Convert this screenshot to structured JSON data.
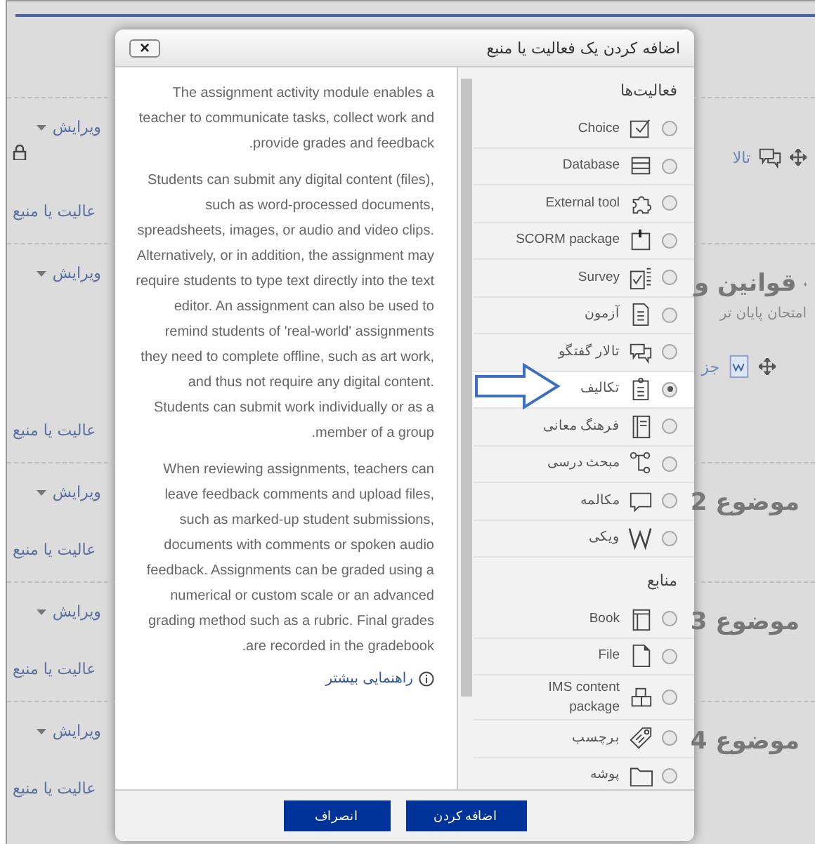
{
  "background": {
    "left_sections": [
      {
        "edit": "ویرایش",
        "locked": true,
        "link": "عالیت یا منبع"
      },
      {
        "edit": "ویرایش",
        "locked": false,
        "link": "عالیت یا منبع"
      },
      {
        "edit": "ویرایش",
        "locked": false,
        "link": "عالیت یا منبع"
      },
      {
        "edit": "ویرایش",
        "locked": false,
        "link": "عالیت یا منبع"
      },
      {
        "edit": "ویرایش",
        "locked": false,
        "link": "عالیت یا منبع"
      }
    ],
    "right_sections": [
      {
        "kind": "activity",
        "label": "تالا"
      },
      {
        "kind": "section",
        "title": "قوانین و",
        "summary": "امتحان پایان تر",
        "activity": {
          "label": "جز"
        }
      },
      {
        "kind": "section",
        "title": "موضوع 2"
      },
      {
        "kind": "section",
        "title": "موضوع 3"
      },
      {
        "kind": "section",
        "title": "موضوع 4"
      }
    ]
  },
  "dialog": {
    "title": "اضافه کردن یک فعالیت یا منبع",
    "close": "×",
    "groups": [
      {
        "heading": "فعالیت‌ها",
        "items": [
          {
            "label": "Choice",
            "selected": false
          },
          {
            "label": "Database",
            "selected": false
          },
          {
            "label": "External tool",
            "selected": false
          },
          {
            "label": "SCORM package",
            "selected": false
          },
          {
            "label": "Survey",
            "selected": false
          },
          {
            "label": "آزمون",
            "selected": false
          },
          {
            "label": "تالار گفتگو",
            "selected": false
          },
          {
            "label": "تکالیف",
            "selected": true
          },
          {
            "label": "فرهنگ معانی",
            "selected": false
          },
          {
            "label": "مبحث درسی",
            "selected": false
          },
          {
            "label": "مکالمه",
            "selected": false
          },
          {
            "label": "ویکی",
            "selected": false
          }
        ]
      },
      {
        "heading": "منابع",
        "items": [
          {
            "label": "Book",
            "selected": false
          },
          {
            "label": "File",
            "selected": false
          },
          {
            "label": "IMS content package",
            "selected": false
          },
          {
            "label": "برچسب",
            "selected": false
          },
          {
            "label": "پوشه",
            "selected": false
          }
        ]
      }
    ],
    "description": [
      "The assignment activity module enables a teacher to communicate tasks, collect work and provide grades and feedback.",
      "Students can submit any digital content (files), such as word-processed documents, spreadsheets, images, or audio and video clips. Alternatively, or in addition, the assignment may require students to type text directly into the text editor. An assignment can also be used to remind students of 'real-world' assignments they need to complete offline, such as art work, and thus not require any digital content. Students can submit work individually or as a member of a group.",
      "When reviewing assignments, teachers can leave feedback comments and upload files, such as marked-up student submissions, documents with comments or spoken audio feedback. Assignments can be graded using a numerical or custom scale or an advanced grading method such as a rubric. Final grades are recorded in the gradebook."
    ],
    "help_link": "راهنمایی بیشتر",
    "buttons": [
      {
        "label": "اضافه کردن"
      },
      {
        "label": "انصراف"
      }
    ]
  }
}
